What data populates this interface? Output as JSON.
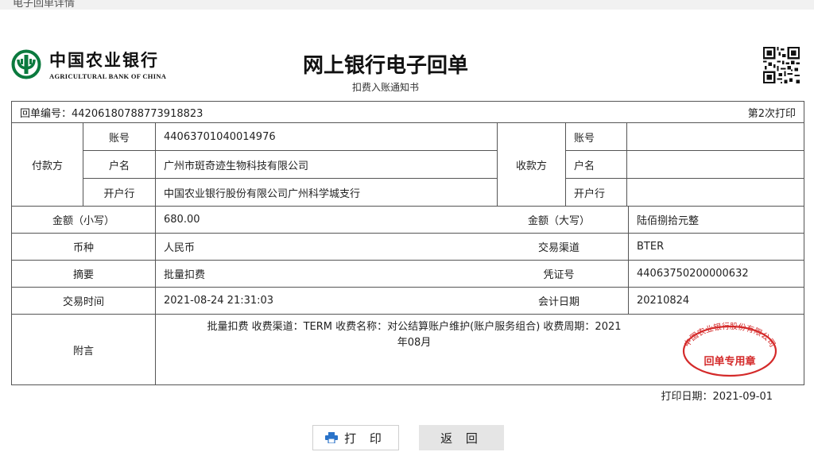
{
  "window": {
    "title": "电子回单详情"
  },
  "header": {
    "bank_name_cn": "中国农业银行",
    "bank_name_en": "AGRICULTURAL BANK OF CHINA",
    "doc_title": "网上银行电子回单",
    "doc_subtitle": "扣费入账通知书"
  },
  "receipt": {
    "number_label": "回单编号：44206180788773918823",
    "print_count": "第2次打印",
    "payer": {
      "group_label": "付款方",
      "account_label": "账号",
      "account": "44063701040014976",
      "name_label": "户名",
      "name": "广州市斑奇迹生物科技有限公司",
      "bank_label": "开户行",
      "bank": "中国农业银行股份有限公司广州科学城支行"
    },
    "payee": {
      "group_label": "收款方",
      "account_label": "账号",
      "account": "",
      "name_label": "户名",
      "name": "",
      "bank_label": "开户行",
      "bank": ""
    },
    "amount_small_label": "金额（小写）",
    "amount_small": "680.00",
    "amount_big_label": "金额（大写）",
    "amount_big": "陆佰捌拾元整",
    "currency_label": "币种",
    "currency": "人民币",
    "channel_label": "交易渠道",
    "channel": "BTER",
    "summary_label": "摘要",
    "summary": "批量扣费",
    "voucher_label": "凭证号",
    "voucher": "44063750200000632",
    "trade_time_label": "交易时间",
    "trade_time": "2021-08-24 21:31:03",
    "accounting_date_label": "会计日期",
    "accounting_date": "20210824",
    "remark_label": "附言",
    "remark_line1": "批量扣费 收费渠道：TERM 收费名称：对公结算账户维护(账户服务组合) 收费周期：2021",
    "remark_line2": "年08月",
    "seal_top": "中国农业银行股份有限公司",
    "seal_bottom": "回单专用章"
  },
  "footer": {
    "print_date": "打印日期：2021-09-01",
    "print_button": "打 印",
    "back_button": "返 回"
  },
  "colors": {
    "brand_green": "#0b7a3e",
    "seal_red": "#d42a2a"
  },
  "icons": {
    "logo": "abc-logo-icon",
    "qr": "qr-code-icon",
    "print": "printer-icon"
  }
}
